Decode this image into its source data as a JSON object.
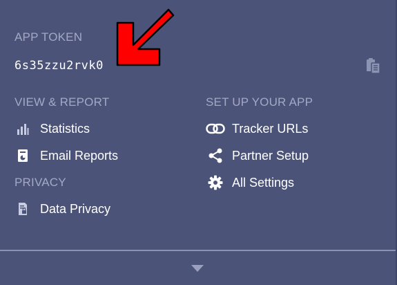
{
  "token_section": {
    "label": "APP TOKEN",
    "token": "6s35zzu2rvk0"
  },
  "view_report": {
    "label": "VIEW & REPORT",
    "items": [
      {
        "label": "Statistics",
        "icon": "bar-chart-icon"
      },
      {
        "label": "Email Reports",
        "icon": "email-report-icon"
      }
    ]
  },
  "privacy": {
    "label": "PRIVACY",
    "items": [
      {
        "label": "Data Privacy",
        "icon": "data-privacy-icon"
      }
    ]
  },
  "setup": {
    "label": "SET UP YOUR APP",
    "items": [
      {
        "label": "Tracker URLs",
        "icon": "link-icon"
      },
      {
        "label": "Partner Setup",
        "icon": "share-icon"
      },
      {
        "label": "All Settings",
        "icon": "gear-icon"
      }
    ]
  },
  "colors": {
    "background": "#4b5478",
    "label": "#a3a9c5",
    "text": "#ffffff",
    "annotation_arrow": "#ff0000"
  }
}
